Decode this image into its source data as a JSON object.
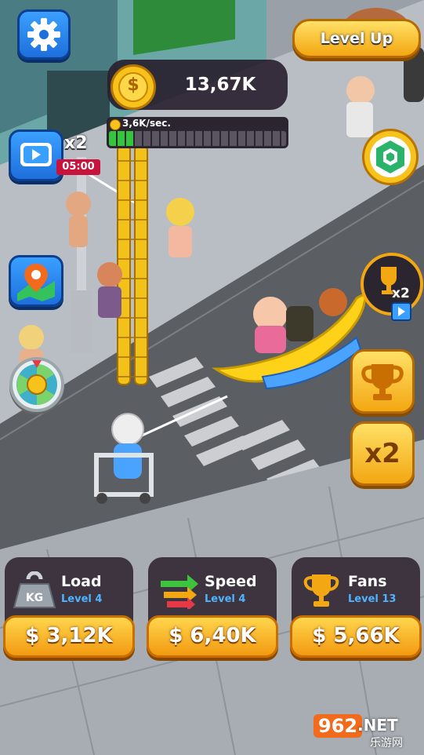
{
  "hud": {
    "coins": "13,67K",
    "rate": "3,6K/sec.",
    "level_up_label": "Level Up",
    "boost_multiplier": "x2",
    "boost_timer": "05:00",
    "fans_boost": "x2",
    "double_label": "x2",
    "coin_symbol": "$"
  },
  "upgrades": [
    {
      "title": "Load",
      "level": "Level 4",
      "price": "$ 3,12K",
      "icon": "weight-icon"
    },
    {
      "title": "Speed",
      "level": "Level 4",
      "price": "$ 6,40K",
      "icon": "arrows-icon"
    },
    {
      "title": "Fans",
      "level": "Level 13",
      "price": "$ 5,66K",
      "icon": "trophy-icon"
    }
  ],
  "scene": {
    "kg_label": "KG"
  },
  "watermark": {
    "brand": "962",
    "domain": ".NET",
    "sub": "乐游网"
  },
  "colors": {
    "accent_gold": "#f3a712",
    "accent_blue": "#1e6fdc",
    "panel": "#3d3440"
  }
}
